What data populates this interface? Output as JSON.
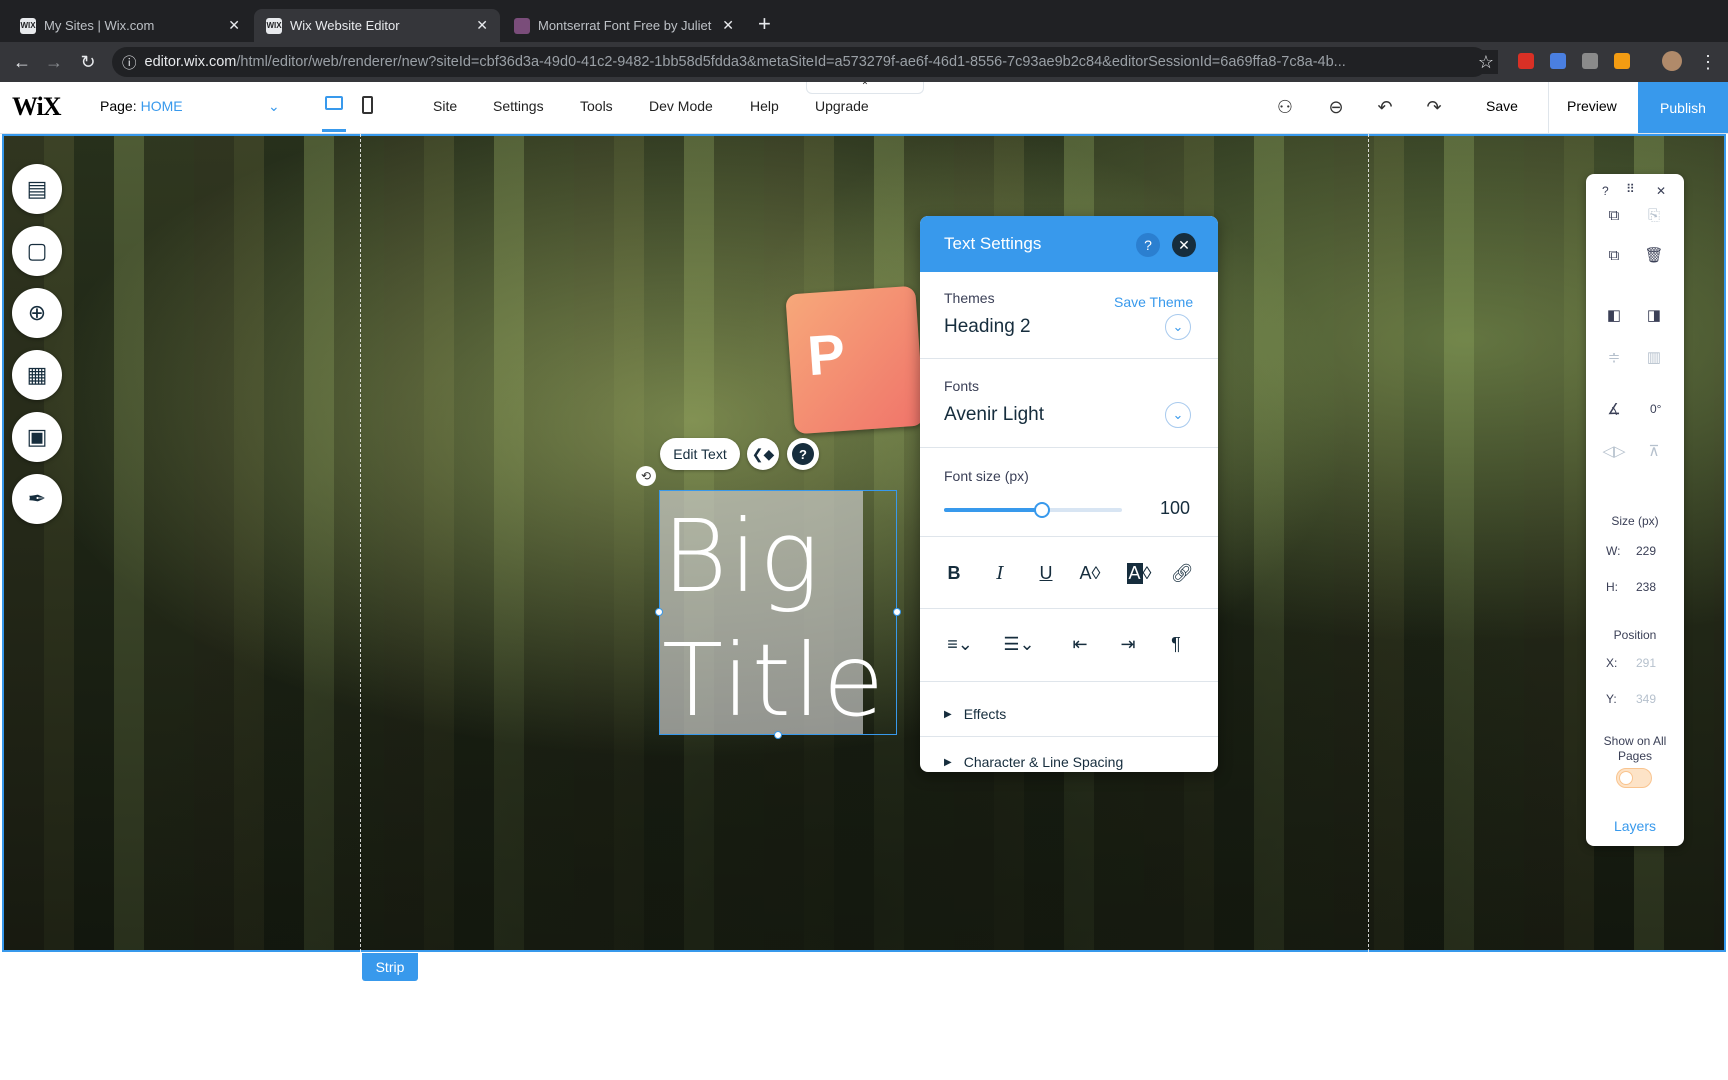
{
  "browser": {
    "tabs": [
      {
        "title": "My Sites | Wix.com",
        "icon": "wix-favicon",
        "active": false
      },
      {
        "title": "Wix Website Editor",
        "icon": "wix-favicon",
        "active": true
      },
      {
        "title": "Montserrat Font Free by Juliet",
        "icon": "font-favicon",
        "active": false
      }
    ],
    "url_host": "editor.wix.com",
    "url_path": "/html/editor/web/renderer/new?siteId=cbf36d3a-49d0-41c2-9482-1bb58d5fdda3&metaSiteId=a573279f-ae6f-46d1-8556-7c93ae9b2c84&editorSessionId=6a69ffa8-7c8a-4b..."
  },
  "wix": {
    "logo": "WiX",
    "page_label": "Page:",
    "page_value": "HOME",
    "menu": [
      "Site",
      "Settings",
      "Tools",
      "Dev Mode",
      "Help",
      "Upgrade"
    ],
    "save": "Save",
    "preview": "Preview",
    "publish": "Publish"
  },
  "canvas": {
    "strip_label": "Strip",
    "title_line1": "Big",
    "title_line2": "Title",
    "edit_text": "Edit Text"
  },
  "text_settings": {
    "title": "Text Settings",
    "themes_label": "Themes",
    "save_theme": "Save Theme",
    "theme_value": "Heading 2",
    "fonts_label": "Fonts",
    "font_value": "Avenir Light",
    "font_size_label": "Font size (px)",
    "font_size_value": "100",
    "font_size_fraction": 0.55,
    "effects": "Effects",
    "spacing": "Character & Line Spacing"
  },
  "right_panel": {
    "angle": "0°",
    "size_label": "Size (px)",
    "w_label": "W:",
    "w_value": "229",
    "h_label": "H:",
    "h_value": "238",
    "position_label": "Position",
    "x_label": "X:",
    "x_value": "291",
    "y_label": "Y:",
    "y_value": "349",
    "show_all_pages": "Show on All Pages",
    "layers": "Layers"
  },
  "colors": {
    "accent": "#3899ec",
    "panel_text": "#162d3d"
  }
}
